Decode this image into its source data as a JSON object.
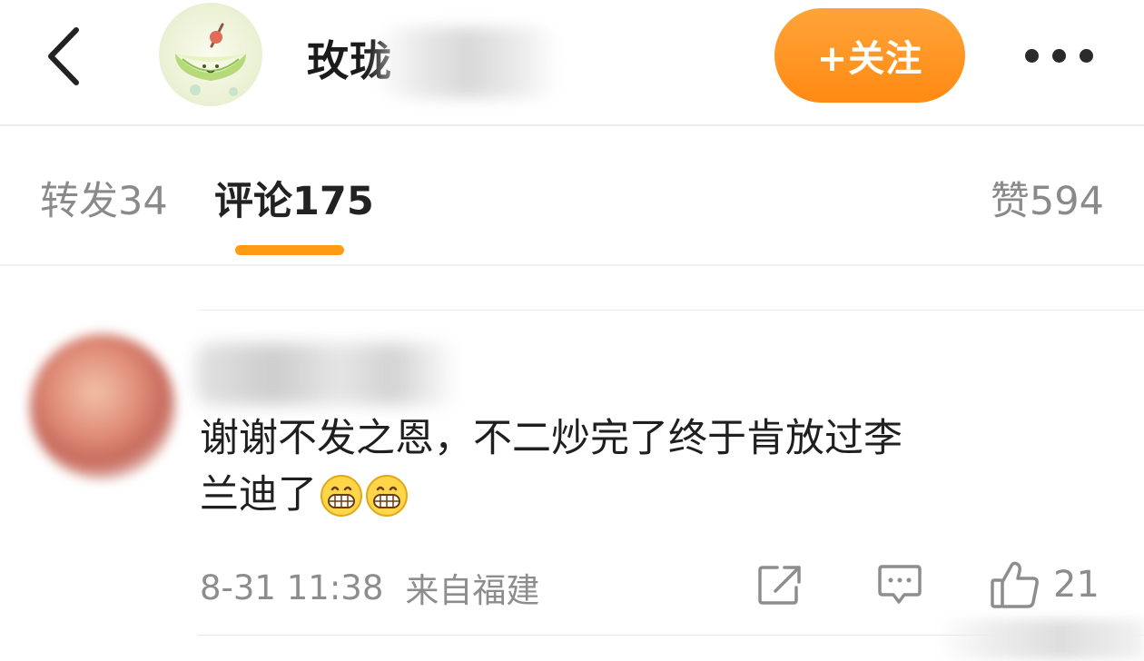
{
  "header": {
    "back_icon": "chevron-left-icon",
    "user_name": "玫珑",
    "follow_label": "+关注",
    "more_icon": "more-icon",
    "accent_color": "#ff9a14"
  },
  "tabs": {
    "repost": "转发34",
    "comment": "评论175",
    "like": "赞594",
    "active": "comment"
  },
  "comment": {
    "text_line1": "谢谢不发之恩，不二炒完了终于肯放过李",
    "text_line2": "兰迪了",
    "emojis": [
      "grin-emoji",
      "grin-emoji"
    ],
    "time": "8-31 11:38",
    "source": "来自福建",
    "like_count": "21",
    "icons": [
      "share-icon",
      "reply-icon",
      "thumbs-up-icon"
    ]
  }
}
